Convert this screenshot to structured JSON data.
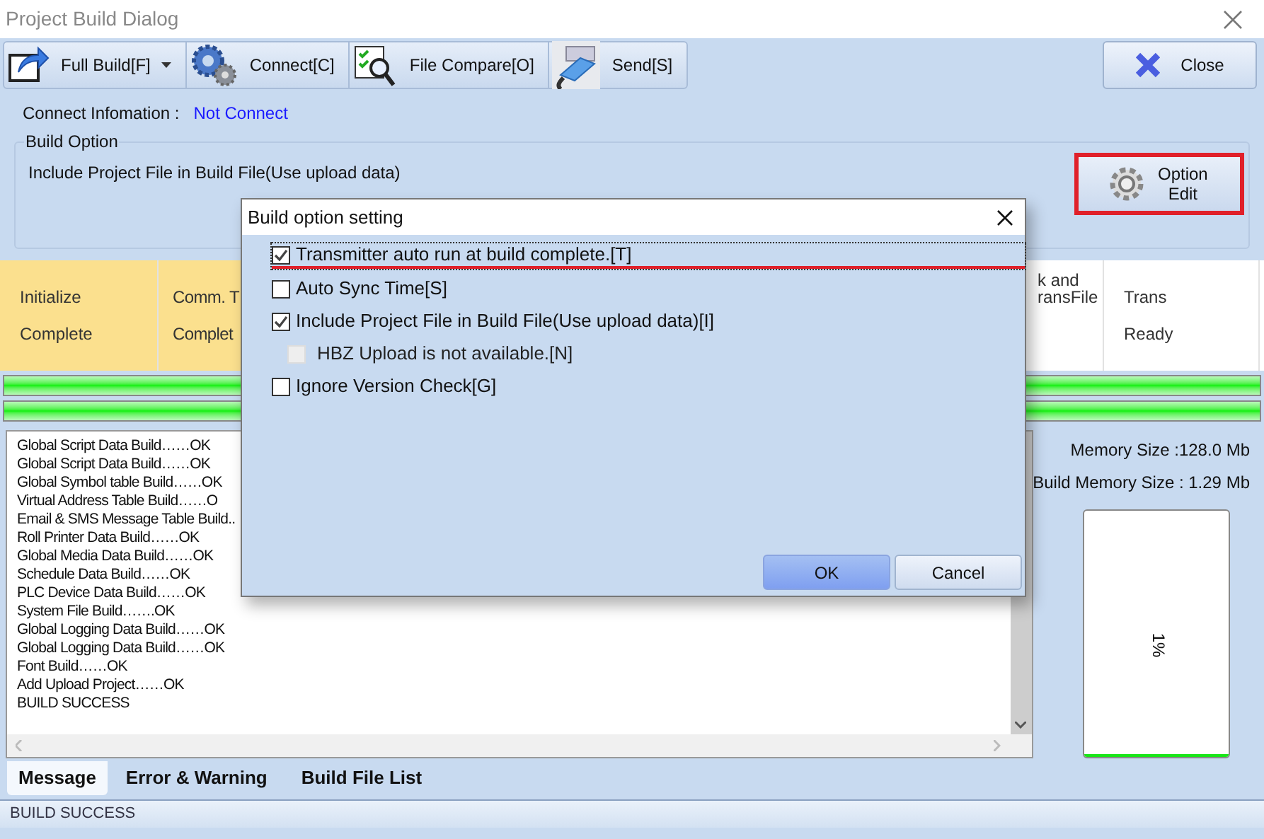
{
  "window": {
    "title": "Project Build Dialog"
  },
  "toolbar": [
    {
      "label": "Full Build[F]",
      "dropdown": true
    },
    {
      "label": "Connect[C]",
      "dropdown": false
    },
    {
      "label": "File Compare[O]",
      "dropdown": false
    },
    {
      "label": "Send[S]",
      "dropdown": false
    }
  ],
  "close_button": {
    "label": "Close"
  },
  "connect_info": {
    "label": "Connect Infomation :",
    "value": "Not Connect"
  },
  "build_option": {
    "title": "Build Option",
    "text": "Include Project File in Build File(Use upload data)",
    "edit_button": {
      "lines": [
        "Option",
        "Edit"
      ],
      "highlighted": true
    }
  },
  "steps": [
    {
      "lines": [
        "Initialize",
        "Complete"
      ],
      "done": true
    },
    {
      "lines": [
        "Comm. T",
        "Complet"
      ],
      "done": true
    },
    {
      "lines": [
        "k and",
        "ransFile"
      ],
      "done": false
    },
    {
      "lines": [
        "Trans",
        "Ready"
      ],
      "done": false
    }
  ],
  "progress_bars": [
    {
      "level": 1
    },
    {
      "level": 1
    }
  ],
  "log": {
    "lines": [
      "Global Script Data Build……OK",
      "Global Script Data Build……OK",
      "Global Symbol table Build……OK",
      "Virtual Address Table Build……O",
      "Email & SMS Message Table Build..",
      "Roll Printer Data Build……OK",
      "Global Media Data Build……OK",
      "Schedule Data Build……OK",
      "PLC Device Data Build……OK",
      "System File Build…….OK",
      "Global Logging Data Build……OK",
      "Global Logging Data Build……OK",
      "Font Build……OK",
      "Add Upload Project……OK",
      "BUILD SUCCESS"
    ]
  },
  "memory": {
    "size": "Memory Size :128.0 Mb",
    "build_size": "Build Memory Size : 1.29 Mb",
    "reading": "1%",
    "level": 0.01
  },
  "tabs": [
    {
      "label": "Message",
      "selected": true
    },
    {
      "label": "Error & Warning",
      "selected": false
    },
    {
      "label": "Build File List",
      "selected": false
    }
  ],
  "status_bar": "BUILD SUCCESS",
  "dialog": {
    "title": "Build option setting",
    "options": [
      {
        "label": "Transmitter auto run at build complete.[T]",
        "checked": true,
        "disabled": false,
        "focused": true,
        "highlighted": true
      },
      {
        "label": "Auto Sync Time[S]",
        "checked": false,
        "disabled": false,
        "focused": false,
        "highlighted": false
      },
      {
        "label": "Include Project File in Build File(Use upload data)[I]",
        "checked": true,
        "disabled": false,
        "focused": false,
        "highlighted": false,
        "children": [
          {
            "label": "HBZ Upload is not available.[N]",
            "checked": false,
            "disabled": true,
            "focused": false,
            "highlighted": false
          }
        ]
      },
      {
        "label": "Ignore Version Check[G]",
        "checked": false,
        "disabled": false,
        "focused": false,
        "highlighted": false
      }
    ],
    "buttons": [
      {
        "label": "OK",
        "default": true
      },
      {
        "label": "Cancel",
        "default": false
      }
    ]
  }
}
